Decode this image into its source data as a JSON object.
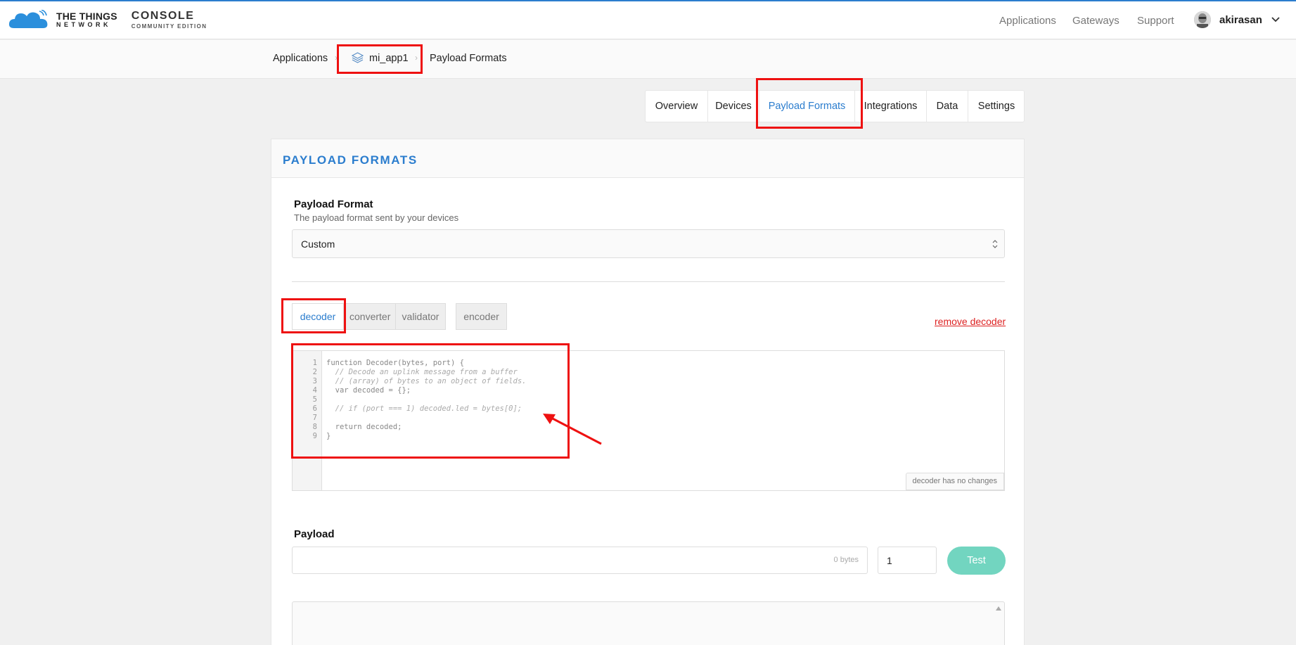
{
  "header": {
    "brand_line1": "THE THINGS",
    "brand_line2": "NETWORK",
    "console_line1": "CONSOLE",
    "console_line2": "COMMUNITY EDITION",
    "nav": [
      "Applications",
      "Gateways",
      "Support"
    ],
    "username": "akirasan"
  },
  "breadcrumb": [
    "Applications",
    "mi_app1",
    "Payload Formats"
  ],
  "app_tabs": [
    {
      "label": "Overview"
    },
    {
      "label": "Devices"
    },
    {
      "label": "Payload Formats",
      "active": true
    },
    {
      "label": "Integrations"
    },
    {
      "label": "Data"
    },
    {
      "label": "Settings"
    }
  ],
  "card": {
    "title": "PAYLOAD FORMATS",
    "payload_format_label": "Payload Format",
    "payload_format_help": "The payload format sent by your devices",
    "payload_format_value": "Custom",
    "function_tabs": [
      "decoder",
      "converter",
      "validator",
      "encoder"
    ],
    "active_function_tab": "decoder",
    "remove_link": "remove decoder",
    "editor_status": "decoder has no changes",
    "code_lines": [
      "function Decoder(bytes, port) {",
      "  // Decode an uplink message from a buffer",
      "  // (array) of bytes to an object of fields.",
      "  var decoded = {};",
      "",
      "  // if (port === 1) decoded.led = bytes[0];",
      "",
      "  return decoded;",
      "}"
    ],
    "line_numbers": [
      "1",
      "2",
      "3",
      "4",
      "5",
      "6",
      "7",
      "8",
      "9"
    ],
    "payload_label": "Payload",
    "payload_bytes": "0 bytes",
    "port_value": "1",
    "test_button": "Test"
  },
  "colors": {
    "accent": "#2b7dce",
    "annotation_red": "#ee1111",
    "test_button": "#72d5c0",
    "remove_link": "#dd2222"
  }
}
